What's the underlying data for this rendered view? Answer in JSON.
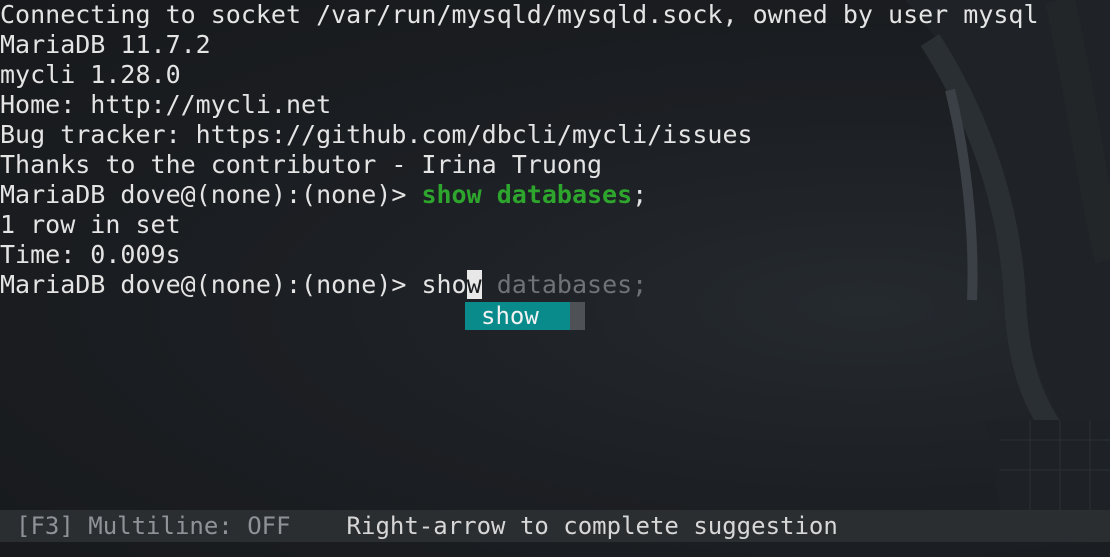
{
  "output_lines": [
    "Connecting to socket /var/run/mysqld/mysqld.sock, owned by user mysql",
    "MariaDB 11.7.2",
    "mycli 1.28.0",
    "Home: http://mycli.net",
    "Bug tracker: https://github.com/dbcli/mycli/issues",
    "Thanks to the contributor - Irina Truong"
  ],
  "prompt": "MariaDB dove@(none):(none)> ",
  "first_command": {
    "text": "show databases",
    "terminator": ";"
  },
  "result": {
    "rows": "1 row in set",
    "time": "Time: 0.009s"
  },
  "current_input": {
    "typed": "sho",
    "cursor_char": "w",
    "autosuggest": " databases;"
  },
  "completion_menu": {
    "items": [
      "show"
    ]
  },
  "toolbar": {
    "multiline_status": "[F3] Multiline: OFF",
    "hint": "Right-arrow to complete suggestion"
  },
  "colors": {
    "command_keyword": "#2ea62e",
    "completion_bg": "#0a8b8b",
    "background": "#1a1d20"
  }
}
